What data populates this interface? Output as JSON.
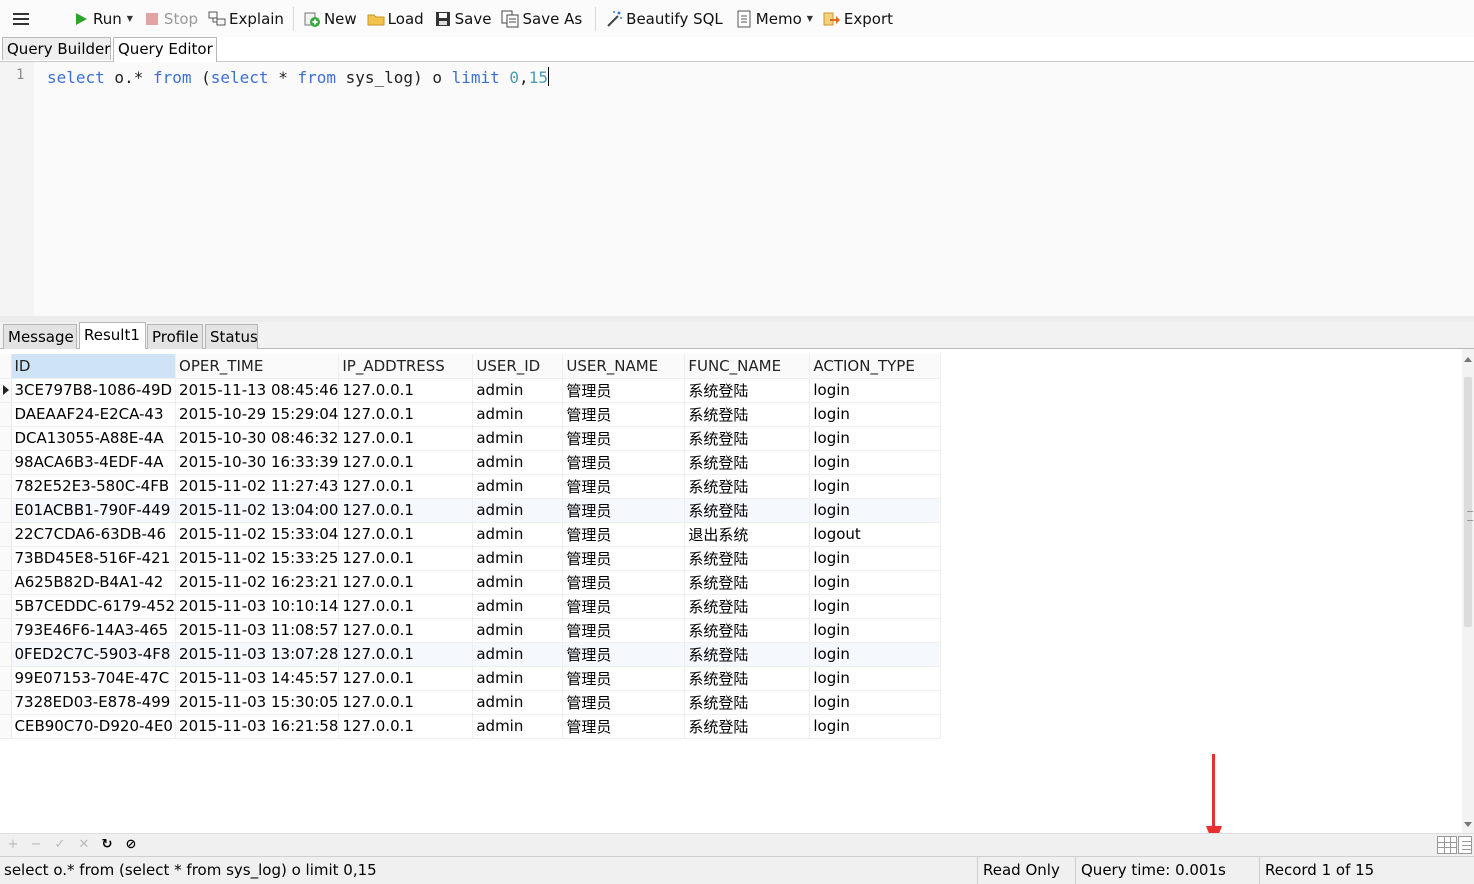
{
  "toolbar": {
    "run": "Run",
    "stop": "Stop",
    "explain": "Explain",
    "new": "New",
    "load": "Load",
    "save": "Save",
    "save_as": "Save As",
    "beautify": "Beautify SQL",
    "memo": "Memo",
    "export": "Export"
  },
  "editor_tabs": [
    "Query Builder",
    "Query Editor"
  ],
  "editor": {
    "line_number": "1",
    "code_tokens": {
      "t1": "select",
      "t2": " o.* ",
      "t3": "from",
      "t4": " (",
      "t5": "select",
      "t6": " * ",
      "t7": "from",
      "t8": " sys_log) o ",
      "t9": "limit",
      "t10": " ",
      "t11": "0",
      "t12": ",",
      "t13": "15"
    }
  },
  "result_tabs": [
    "Message",
    "Result1",
    "Profile",
    "Status"
  ],
  "grid": {
    "columns": [
      "ID",
      "OPER_TIME",
      "IP_ADDTRESS",
      "USER_ID",
      "USER_NAME",
      "FUNC_NAME",
      "ACTION_TYPE"
    ],
    "rows": [
      [
        "3CE797B8-1086-49D",
        "2015-11-13 08:45:46",
        "127.0.0.1",
        "admin",
        "管理员",
        "系统登陆",
        "login"
      ],
      [
        "DAEAAF24-E2CA-43",
        "2015-10-29 15:29:04",
        "127.0.0.1",
        "admin",
        "管理员",
        "系统登陆",
        "login"
      ],
      [
        "DCA13055-A88E-4A",
        "2015-10-30 08:46:32",
        "127.0.0.1",
        "admin",
        "管理员",
        "系统登陆",
        "login"
      ],
      [
        "98ACA6B3-4EDF-4A",
        "2015-10-30 16:33:39",
        "127.0.0.1",
        "admin",
        "管理员",
        "系统登陆",
        "login"
      ],
      [
        "782E52E3-580C-4FB",
        "2015-11-02 11:27:43",
        "127.0.0.1",
        "admin",
        "管理员",
        "系统登陆",
        "login"
      ],
      [
        "E01ACBB1-790F-449",
        "2015-11-02 13:04:00",
        "127.0.0.1",
        "admin",
        "管理员",
        "系统登陆",
        "login"
      ],
      [
        "22C7CDA6-63DB-46",
        "2015-11-02 15:33:04",
        "127.0.0.1",
        "admin",
        "管理员",
        "退出系统",
        "logout"
      ],
      [
        "73BD45E8-516F-421",
        "2015-11-02 15:33:25",
        "127.0.0.1",
        "admin",
        "管理员",
        "系统登陆",
        "login"
      ],
      [
        "A625B82D-B4A1-42",
        "2015-11-02 16:23:21",
        "127.0.0.1",
        "admin",
        "管理员",
        "系统登陆",
        "login"
      ],
      [
        "5B7CEDDC-6179-452",
        "2015-11-03 10:10:14",
        "127.0.0.1",
        "admin",
        "管理员",
        "系统登陆",
        "login"
      ],
      [
        "793E46F6-14A3-465",
        "2015-11-03 11:08:57",
        "127.0.0.1",
        "admin",
        "管理员",
        "系统登陆",
        "login"
      ],
      [
        "0FED2C7C-5903-4F8",
        "2015-11-03 13:07:28",
        "127.0.0.1",
        "admin",
        "管理员",
        "系统登陆",
        "login"
      ],
      [
        "99E07153-704E-47C",
        "2015-11-03 14:45:57",
        "127.0.0.1",
        "admin",
        "管理员",
        "系统登陆",
        "login"
      ],
      [
        "7328ED03-E878-499",
        "2015-11-03 15:30:05",
        "127.0.0.1",
        "admin",
        "管理员",
        "系统登陆",
        "login"
      ],
      [
        "CEB90C70-D920-4E0",
        "2015-11-03 16:21:58",
        "127.0.0.1",
        "admin",
        "管理员",
        "系统登陆",
        "login"
      ]
    ]
  },
  "grid_footer": {
    "add": "+",
    "delete": "−",
    "apply": "✓",
    "discard": "✕",
    "refresh": "↻",
    "stop": "⊘"
  },
  "status": {
    "sql": "select o.* from (select * from sys_log) o limit 0,15",
    "mode": "Read Only",
    "query_time": "Query time: 0.001s",
    "record": "Record 1 of 15"
  },
  "colors": {
    "keyword": "#3d6fd6",
    "number": "#4c9bb0",
    "selected_header": "#cfe3f7",
    "annotation": "#e8302f"
  },
  "icons": [
    "menu-icon",
    "run-icon",
    "stop-icon",
    "explain-icon",
    "new-icon",
    "load-icon",
    "save-icon",
    "save-as-icon",
    "beautify-icon",
    "memo-icon",
    "export-icon"
  ]
}
